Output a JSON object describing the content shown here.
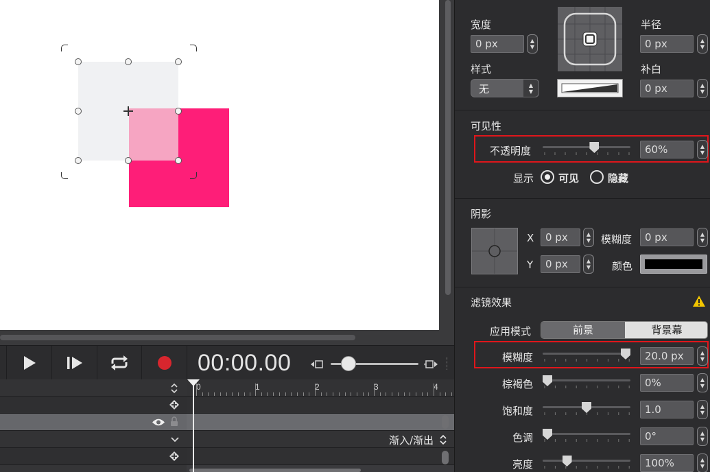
{
  "canvas": {
    "shapes": [
      {
        "name": "gray-rect",
        "color": "#f0f1f3"
      },
      {
        "name": "pink-rect",
        "color": "#fe1e78"
      }
    ]
  },
  "transport": {
    "time": "00:00.00",
    "buttons": [
      "play-icon",
      "step-forward-icon",
      "loop-icon",
      "record-icon"
    ],
    "record_color": "#d8262e"
  },
  "timeline": {
    "ruler_ticks": [
      "0",
      "1",
      "2",
      "3",
      "4"
    ],
    "ease_label": "渐入/渐出"
  },
  "inspector": {
    "geometry": {
      "width_label": "宽度",
      "width_value": "0 px",
      "style_label": "样式",
      "style_value": "无",
      "radius_label": "半径",
      "radius_value": "0 px",
      "padding_label": "补白",
      "padding_value": "0 px"
    },
    "visibility": {
      "title": "可见性",
      "opacity_label": "不透明度",
      "opacity_value": "60%",
      "opacity_level": 0.6,
      "display_label": "显示",
      "visible_label": "可见",
      "hidden_label": "隐藏"
    },
    "shadow": {
      "title": "阴影",
      "x_label": "X",
      "x_value": "0 px",
      "y_label": "Y",
      "y_value": "0 px",
      "blur_label": "模糊度",
      "blur_value": "0 px",
      "color_label": "颜色",
      "color_swatch": "#000000"
    },
    "filters": {
      "title": "滤镜效果",
      "warning_icon": "warning-icon",
      "apply_mode_label": "应用模式",
      "mode_foreground": "前景",
      "mode_background": "背景幕",
      "rows": [
        {
          "label": "模糊度",
          "value": "20.0 px",
          "level": 1.0
        },
        {
          "label": "棕褐色",
          "value": "0%",
          "level": 0.0
        },
        {
          "label": "饱和度",
          "value": "1.0",
          "level": 0.5
        },
        {
          "label": "色调",
          "value": "0°",
          "level": 0.0
        },
        {
          "label": "亮度",
          "value": "100%",
          "level": 0.25
        }
      ]
    }
  }
}
